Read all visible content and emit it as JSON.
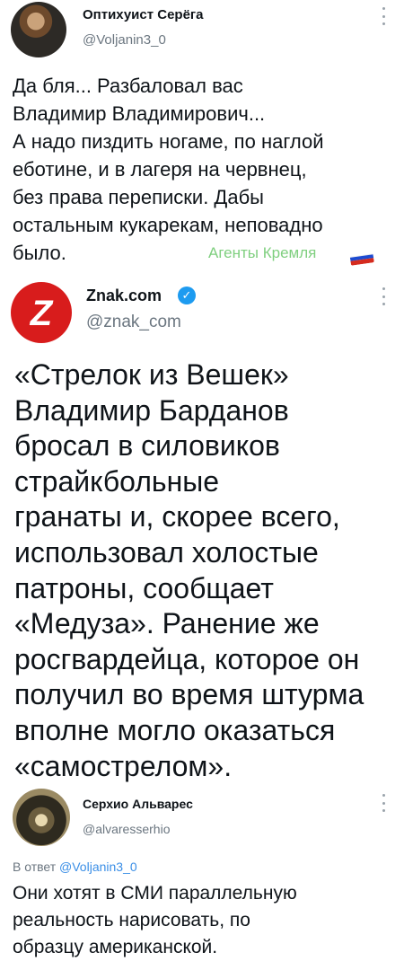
{
  "tweets": [
    {
      "name": "Оптихуист Серёга",
      "handle": "@Voljanin3_0",
      "avatar_icon": "profile-photo",
      "text": "Да бля... Разбаловал вас\nВладимир Владимирович...\nА надо пиздить ногаме, по наглой\nеботине, и в лагеря на червнец,\nбез права переписки. Дабы\nостальным кукарекам, неповадно\nбыло.",
      "watermark": "Агенты Кремля",
      "flag_colors": [
        "#ffffff",
        "#1d4bd1",
        "#d52b1e"
      ]
    },
    {
      "name": "Znak.com",
      "handle": "@znak_com",
      "avatar_letter": "Z",
      "avatar_color": "#d81c1c",
      "verified_mark": "✓",
      "text": "«Стрелок из Вешек»\nВладимир Барданов\nбросал в силовиков\nстрайкбольные\nгранаты и, скорее всего,\nиспользовал холостые\nпатроны, сообщает\n«Медуза». Ранение же\nросгвардейца, которое он\nполучил во время штурма\nвполне могло оказаться\n«самострелом»."
    },
    {
      "name": "Серхио Альварес",
      "handle": "@alvaresserhio",
      "avatar_icon": "profile-photo",
      "reply_prefix": "В ответ",
      "reply_handle": "@Voljanin3_0",
      "text": "Они хотят в СМИ параллельную\nреальность нарисовать, по\nобразцу американской."
    }
  ],
  "accent_color": "#1d9bf0"
}
